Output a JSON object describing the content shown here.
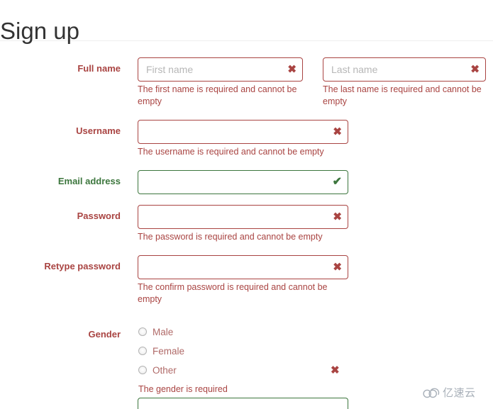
{
  "header": {
    "title": "Sign up"
  },
  "form": {
    "fields": [
      {
        "key": "full_name",
        "label": "Full name",
        "state": "error",
        "inputs": [
          {
            "name": "first-name",
            "placeholder": "First name",
            "value": "",
            "state": "error",
            "icon": "error-cross-icon",
            "help": "The first name is required and cannot be empty"
          },
          {
            "name": "last-name",
            "placeholder": "Last name",
            "value": "",
            "state": "error",
            "icon": "error-cross-icon",
            "help": "The last name is required and cannot be empty"
          }
        ]
      },
      {
        "key": "username",
        "label": "Username",
        "state": "error",
        "inputs": [
          {
            "name": "username",
            "placeholder": "",
            "value": "",
            "state": "error",
            "icon": "error-cross-icon",
            "help": "The username is required and cannot be empty"
          }
        ]
      },
      {
        "key": "email",
        "label": "Email address",
        "state": "valid",
        "inputs": [
          {
            "name": "email",
            "placeholder": "",
            "value": "",
            "state": "valid",
            "icon": "success-check-icon",
            "help": ""
          }
        ]
      },
      {
        "key": "password",
        "label": "Password",
        "state": "error",
        "inputs": [
          {
            "name": "password",
            "placeholder": "",
            "value": "",
            "state": "error",
            "icon": "error-cross-icon",
            "help": "The password is required and cannot be empty"
          }
        ]
      },
      {
        "key": "retype_password",
        "label": "Retype password",
        "state": "error",
        "inputs": [
          {
            "name": "retype-password",
            "placeholder": "",
            "value": "",
            "state": "error",
            "icon": "error-cross-icon",
            "help": "The confirm password is required and cannot be empty"
          }
        ]
      },
      {
        "key": "gender",
        "label": "Gender",
        "state": "error",
        "icon": "error-cross-icon",
        "options": [
          {
            "label": "Male",
            "value": "male",
            "checked": false
          },
          {
            "label": "Female",
            "value": "female",
            "checked": false
          },
          {
            "label": "Other",
            "value": "other",
            "checked": false
          }
        ],
        "help": "The gender is required"
      }
    ],
    "next_field_partial": {
      "name": "next-field",
      "state": "valid"
    }
  },
  "icons": {
    "error_cross": "✖",
    "success_check": "✔"
  },
  "watermark": {
    "text": "亿速云",
    "icon": "cloud-icon"
  },
  "colors": {
    "error": "#a94442",
    "valid": "#3c763d",
    "title": "#333333",
    "placeholder": "#b7b7b7",
    "watermark": "#9aa3ad"
  }
}
